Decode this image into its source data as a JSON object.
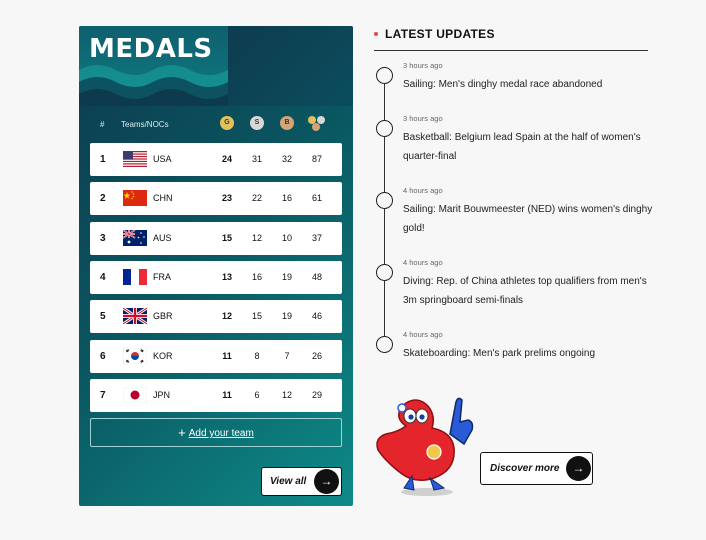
{
  "medals": {
    "title": "MEDALS",
    "header": {
      "rank": "#",
      "team": "Teams/NOCs",
      "gold": "G",
      "silver": "S",
      "bronze": "B"
    },
    "rows": [
      {
        "rank": "1",
        "code": "USA",
        "gold": "24",
        "silver": "31",
        "bronze": "32",
        "total": "87",
        "flag": "usa"
      },
      {
        "rank": "2",
        "code": "CHN",
        "gold": "23",
        "silver": "22",
        "bronze": "16",
        "total": "61",
        "flag": "chn"
      },
      {
        "rank": "3",
        "code": "AUS",
        "gold": "15",
        "silver": "12",
        "bronze": "10",
        "total": "37",
        "flag": "aus"
      },
      {
        "rank": "4",
        "code": "FRA",
        "gold": "13",
        "silver": "16",
        "bronze": "19",
        "total": "48",
        "flag": "fra"
      },
      {
        "rank": "5",
        "code": "GBR",
        "gold": "12",
        "silver": "15",
        "bronze": "19",
        "total": "46",
        "flag": "gbr"
      },
      {
        "rank": "6",
        "code": "KOR",
        "gold": "11",
        "silver": "8",
        "bronze": "7",
        "total": "26",
        "flag": "kor"
      },
      {
        "rank": "7",
        "code": "JPN",
        "gold": "11",
        "silver": "6",
        "bronze": "12",
        "total": "29",
        "flag": "jpn"
      }
    ],
    "add_team_label": "Add your team",
    "view_all_label": "View all"
  },
  "updates": {
    "title": "LATEST UPDATES",
    "items": [
      {
        "time": "3 hours ago",
        "text": "Sailing: Men's dinghy medal race abandoned"
      },
      {
        "time": "3 hours ago",
        "text": "Basketball: Belgium lead Spain at the half of women's quarter-final"
      },
      {
        "time": "4 hours ago",
        "text": "Sailing: Marit Bouwmeester (NED) wins women's dinghy gold!"
      },
      {
        "time": "4 hours ago",
        "text": "Diving: Rep. of China athletes top qualifiers from men's 3m springboard semi-finals"
      },
      {
        "time": "4 hours ago",
        "text": "Skateboarding: Men's park prelims ongoing"
      }
    ],
    "discover_label": "Discover more"
  },
  "icons": {
    "arrow": "arrow-right-icon",
    "plus": "plus-icon"
  },
  "colors": {
    "panel_dark": "#0e3a4e",
    "panel_teal": "#0e8a88",
    "gold": "#e2c15a",
    "silver": "#d7d7d7",
    "bronze": "#d4a574",
    "accent_dot": "#e5484d"
  }
}
